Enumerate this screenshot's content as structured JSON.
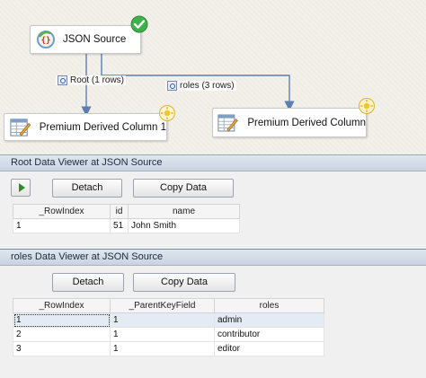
{
  "designer": {
    "source_node": {
      "label": "JSON Source"
    },
    "path_root": {
      "label": "Root (1 rows)"
    },
    "path_roles": {
      "label": "roles (3 rows)"
    },
    "dest_node_1": {
      "label": "Premium Derived Column 1"
    },
    "dest_node_2": {
      "label": "Premium Derived Column"
    }
  },
  "viewer_root": {
    "title": "Root Data Viewer at JSON Source",
    "detach_label": "Detach",
    "copy_label": "Copy Data",
    "columns": [
      "_RowIndex",
      "id",
      "name"
    ],
    "rows": [
      [
        "1",
        "51",
        "John Smith"
      ]
    ]
  },
  "viewer_roles": {
    "title": "roles Data Viewer at JSON Source",
    "detach_label": "Detach",
    "copy_label": "Copy Data",
    "columns": [
      "_RowIndex",
      "_ParentKeyField",
      "roles"
    ],
    "rows": [
      [
        "1",
        "1",
        "admin"
      ],
      [
        "2",
        "1",
        "contributor"
      ],
      [
        "3",
        "1",
        "editor"
      ]
    ]
  },
  "colors": {
    "success_check": "#3db14a",
    "path_arrow": "#5b7fb0",
    "selected_row": "#e5ebf4"
  }
}
